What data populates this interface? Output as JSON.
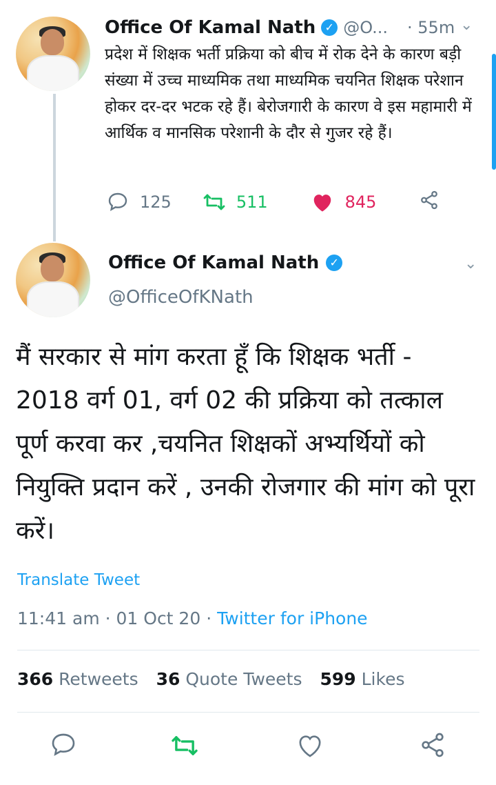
{
  "reply_tweet": {
    "author_name": "Office Of Kamal Nath",
    "handle_truncated": "@O...",
    "time": "· 55m",
    "text": "प्रदेश में शिक्षक भर्ती प्रक्रिया को बीच में रोक देने के कारण बड़ी संख्या में उच्च माध्यमिक तथा माध्यमिक चयनित शिक्षक परेशान होकर दर-दर भटक रहे हैं। बेरोजगारी के कारण वे इस महामारी में आर्थिक व मानसिक परेशानी के दौर से गुजर रहे हैं।",
    "reply_count": "125",
    "retweet_count": "511",
    "like_count": "845"
  },
  "main_tweet": {
    "author_name": "Office Of Kamal Nath",
    "handle": "@OfficeOfKNath",
    "text": "मैं सरकार से मांग करता हूँ कि शिक्षक भर्ती - 2018 वर्ग 01, वर्ग 02 की प्रक्रिया को तत्काल पूर्ण करवा कर ,चयनित शिक्षकों अभ्यर्थियों को नियुक्ति प्रदान करें , उनकी रोजगार की मांग को पूरा करें।",
    "translate_label": "Translate Tweet",
    "timestamp": "11:41 am · 01 Oct 20 ·",
    "source": "Twitter for iPhone",
    "stats": {
      "retweets_num": "366",
      "retweets_label": "Retweets",
      "quotes_num": "36",
      "quotes_label": "Quote Tweets",
      "likes_num": "599",
      "likes_label": "Likes"
    }
  },
  "colors": {
    "accent": "#1da1f2",
    "retweet_green": "#17bf63",
    "like_red": "#e0245e",
    "muted": "#657786"
  },
  "icons": {
    "verified": "verified-badge-icon",
    "reply": "comment-bubble-icon",
    "retweet": "retweet-arrows-icon",
    "like": "heart-icon",
    "share": "share-nodes-icon",
    "menu": "chevron-down-icon"
  }
}
